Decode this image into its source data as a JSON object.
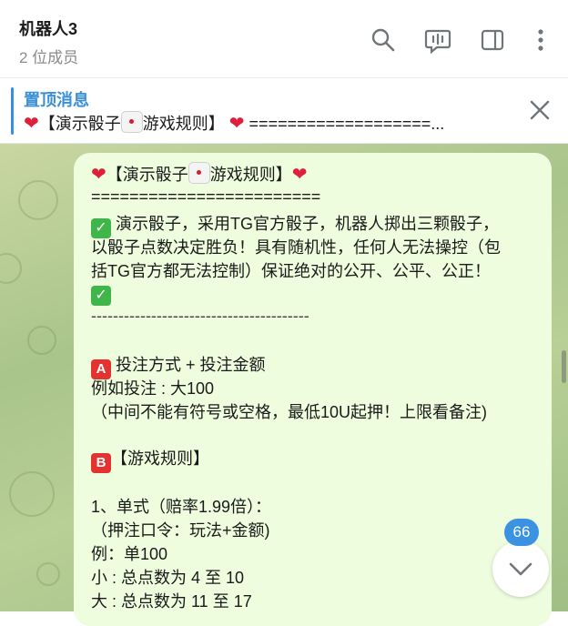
{
  "header": {
    "title": "机器人3",
    "subtitle": "2 位成员",
    "icons": [
      "search-icon",
      "live-chat-icon",
      "sidebar-icon",
      "more-vertical-icon"
    ]
  },
  "pinned": {
    "title": "置顶消息",
    "text_heart": "❤️",
    "text_a": "【演示骰子",
    "text_b": "游戏规则】",
    "text_c": "❤️",
    "text_d": " ===================..."
  },
  "message": {
    "l1a": "【演示骰子",
    "l1b": "游戏规则】",
    "l2": "========================",
    "l3": " 演示骰子，采用TG官方骰子，机器人掷出三颗骰子，",
    "l4": "以骰子点数决定胜负！具有随机性，任何人无法操控（包",
    "l5": "括TG官方都无法控制）保证绝对的公开、公平、公正！",
    "l7": "----------------------------------------",
    "l8": " 投注方式 + 投注金额",
    "l9": "例如投注 : 大100",
    "l10": "（中间不能有符号或空格，最低10U起押！上限看备注)",
    "l11": "【游戏规则】",
    "l12": "1、单式（赔率1.99倍）：",
    "l13": "（押注口令：玩法+金额)",
    "l14": "例：单100",
    "l15": "小 : 总点数为 4 至 10",
    "l16": "大 : 总点数为 11 至 17",
    "box_a": "A",
    "box_b": "B",
    "check": "✓",
    "heart": "❤"
  },
  "unread_badge": "66",
  "colors": {
    "accent": "#3a8fd6",
    "bubble": "#effddf",
    "badge": "#3b92e0"
  }
}
